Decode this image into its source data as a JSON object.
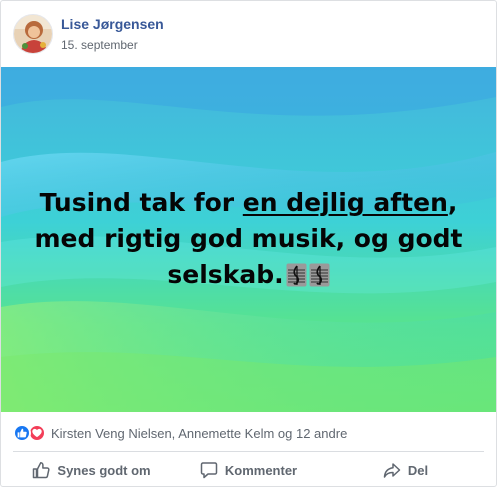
{
  "post": {
    "author": "Lise Jørgensen",
    "date": "15. september",
    "message": {
      "part1": "Tusind tak for ",
      "link": "en dejlig aften",
      "part2": ", med rigtig god musik, og godt selskab."
    }
  },
  "reactions": {
    "icons": [
      "like-icon",
      "love-icon"
    ],
    "names": "Kirsten Veng Nielsen, Annemette Kelm og 12 andre"
  },
  "actions": {
    "like": "Synes godt om",
    "comment": "Kommenter",
    "share": "Del"
  },
  "colors": {
    "author": "#385898",
    "like": "#1877f2",
    "love": "#f33e58",
    "banner_top": "#3fb6d8",
    "banner_bottom": "#5ce878"
  }
}
